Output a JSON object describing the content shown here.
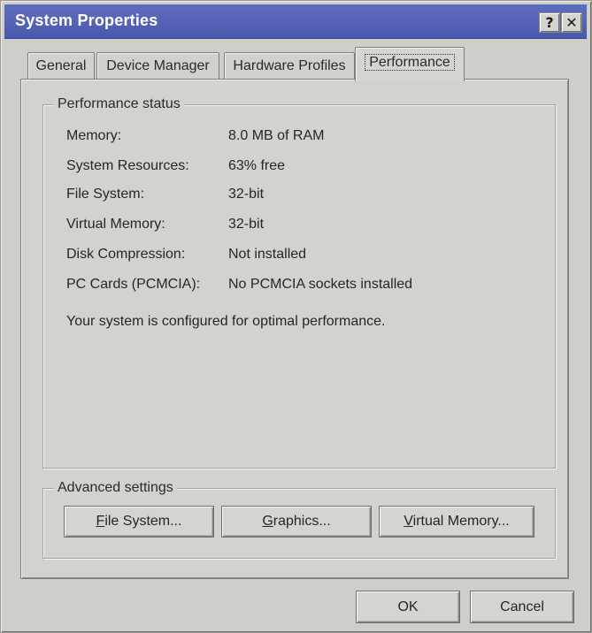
{
  "window": {
    "title": "System Properties",
    "help_glyph": "?",
    "close_glyph": "✕"
  },
  "tabs": [
    {
      "label": "General"
    },
    {
      "label": "Device Manager"
    },
    {
      "label": "Hardware Profiles"
    },
    {
      "label": "Performance",
      "selected": true
    }
  ],
  "status": {
    "legend": "Performance status",
    "rows": [
      {
        "label": "Memory:",
        "value": "8.0 MB of RAM"
      },
      {
        "label": "System Resources:",
        "value": "63% free"
      },
      {
        "label": "File System:",
        "value": "32-bit"
      },
      {
        "label": "Virtual Memory:",
        "value": "32-bit"
      },
      {
        "label": "Disk Compression:",
        "value": "Not installed"
      },
      {
        "label": "PC Cards (PCMCIA):",
        "value": "No PCMCIA sockets installed"
      }
    ],
    "message": "Your system is configured for optimal performance."
  },
  "advanced": {
    "legend": "Advanced settings",
    "file_system": {
      "mnemonic": "F",
      "rest": "ile System..."
    },
    "graphics": {
      "mnemonic": "G",
      "rest": "raphics..."
    },
    "virtual_memory": {
      "mnemonic": "V",
      "rest": "irtual Memory..."
    }
  },
  "footer": {
    "ok": "OK",
    "cancel": "Cancel"
  },
  "colors": {
    "titlebar": "#4a58ad",
    "face": "#d3d3cd"
  }
}
